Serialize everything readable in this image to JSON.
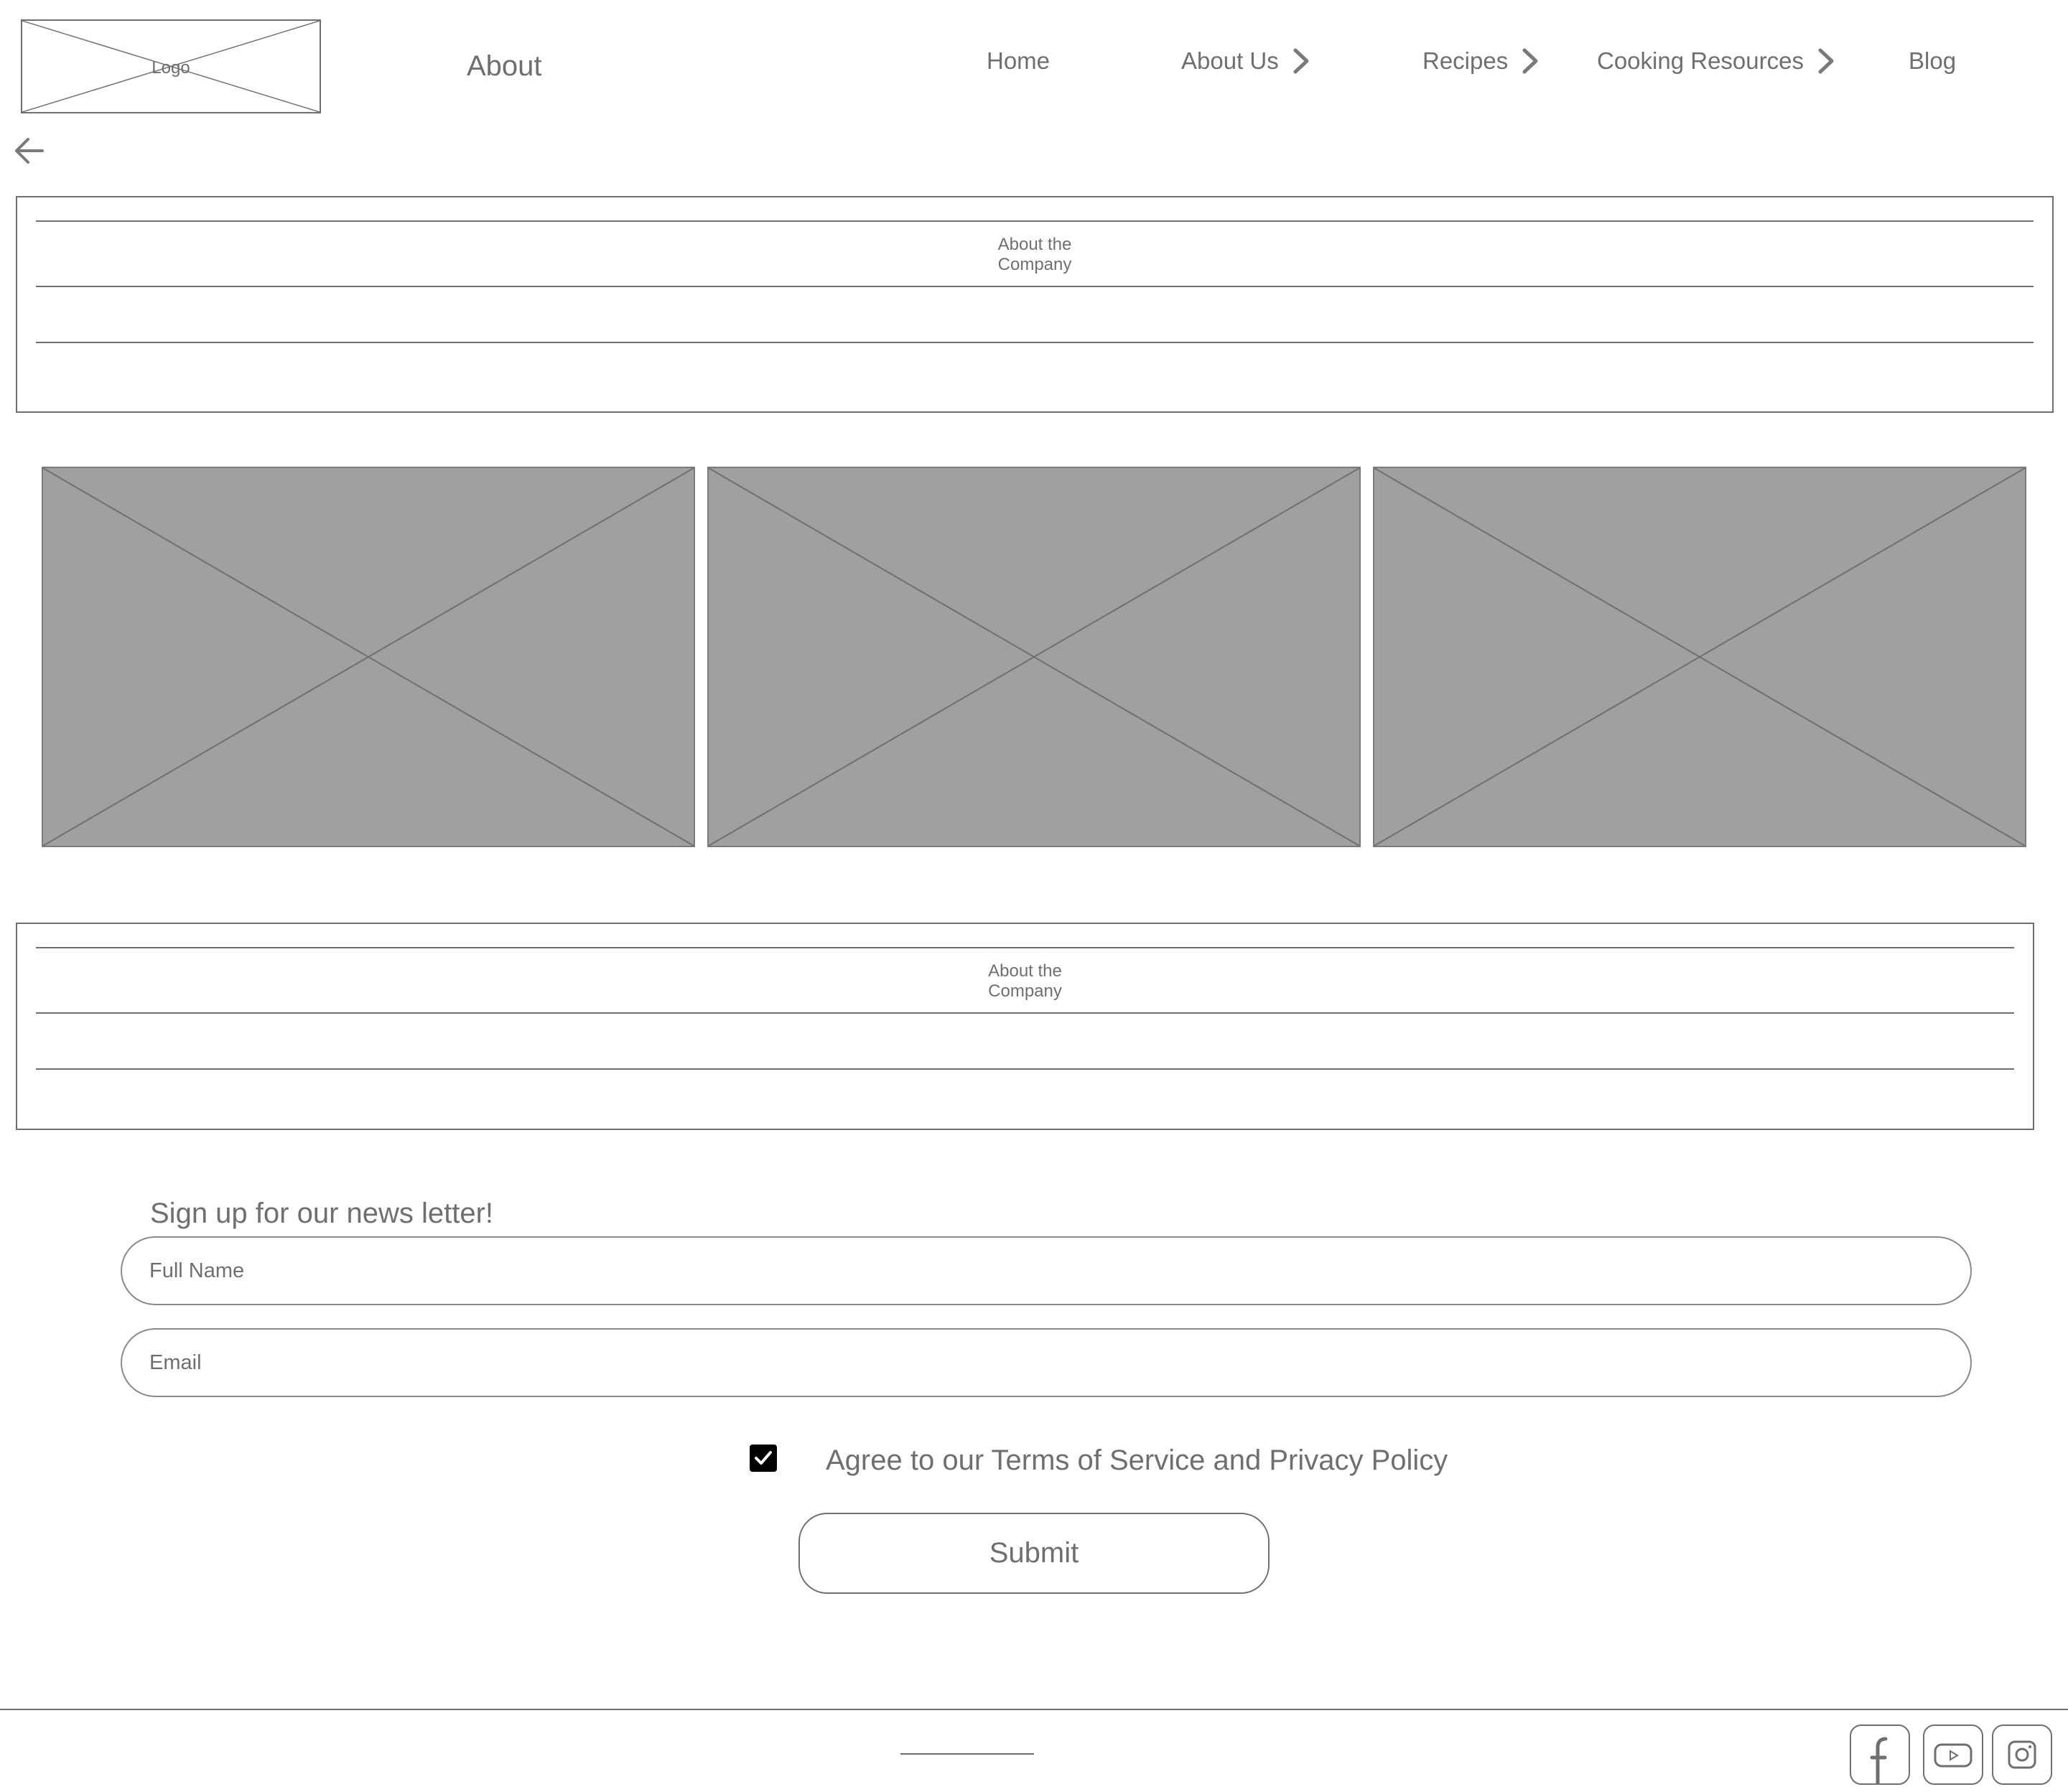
{
  "header": {
    "logo_text": "Logo",
    "page_title": "About"
  },
  "nav": {
    "home": "Home",
    "about_us": "About Us",
    "recipes": "Recipes",
    "cooking_resources": "Cooking Resources",
    "blog": "Blog"
  },
  "sections": {
    "top_box": {
      "caption_line1": "About the",
      "caption_line2": "Company"
    },
    "bottom_box": {
      "caption_line1": "About the",
      "caption_line2": "Company"
    }
  },
  "gallery": {
    "images": [
      "image-placeholder",
      "image-placeholder",
      "image-placeholder"
    ]
  },
  "newsletter": {
    "title": "Sign up for our news letter!",
    "full_name_placeholder": "Full Name",
    "email_placeholder": "Email",
    "agree_text": "Agree to our Terms of Service and Privacy Policy",
    "agree_checked": true,
    "submit_label": "Submit"
  },
  "footer": {
    "social_icons": [
      "facebook-icon",
      "youtube-icon",
      "instagram-icon"
    ]
  },
  "colors": {
    "text": "#6f6f6f",
    "placeholder_fill": "#a0a0a0",
    "checkbox": "#000000",
    "background": "#ffffff"
  }
}
